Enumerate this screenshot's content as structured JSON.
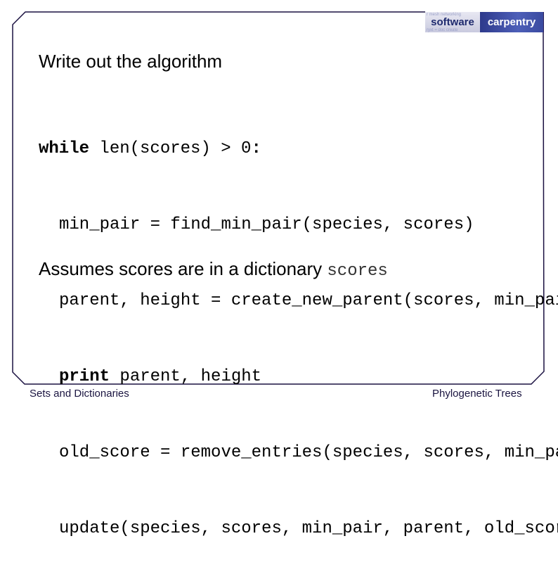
{
  "logo": {
    "word1": "software",
    "word2": "carpentry",
    "faint_text": [
      "r mesh networking",
      "ryxt = doc create"
    ]
  },
  "slide": {
    "title": "Write out the algorithm",
    "code": [
      {
        "keyword": "while",
        "rest": " len(scores) > 0",
        "tail": ":"
      },
      {
        "keyword": "",
        "rest": "min_pair = find_min_pair(species, scores)"
      },
      {
        "keyword": "",
        "rest": "parent, height = create_new_parent(scores, min_pair)"
      },
      {
        "keyword": "print",
        "rest": " parent, height"
      },
      {
        "keyword": "",
        "rest": "old_score = remove_entries(species, scores, min_pair)"
      },
      {
        "keyword": "",
        "rest": "update(species, scores, min_pair, parent, old_score)"
      }
    ],
    "note_text": "Assumes scores are in a dictionary ",
    "note_code": "scores"
  },
  "footer": {
    "left": "Sets and Dictionaries",
    "right": "Phylogenetic Trees"
  },
  "colors": {
    "frame": "#1a1040",
    "logo_dark": "#1e2a6e",
    "logo_blue": "#4d5fb8"
  }
}
